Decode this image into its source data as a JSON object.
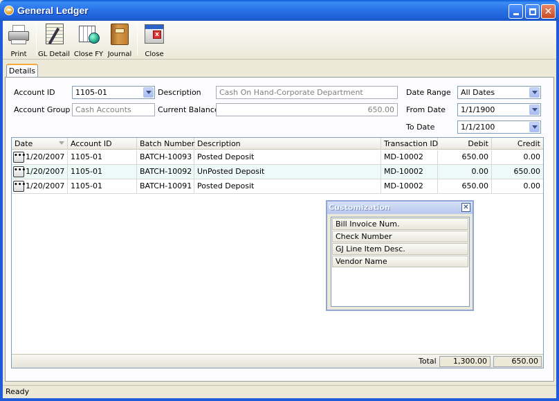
{
  "window": {
    "title": "General Ledger"
  },
  "toolbar": {
    "print": "Print",
    "gl_detail": "GL Detail",
    "close_fy": "Close FY",
    "journal": "Journal",
    "close": "Close"
  },
  "tabs": {
    "details": "Details"
  },
  "form": {
    "account_id_label": "Account ID",
    "account_id_value": "1105-01",
    "description_label": "Description",
    "description_value": "Cash On Hand-Corporate Department",
    "account_group_label": "Account Group",
    "account_group_value": "Cash Accounts",
    "current_balance_label": "Current Balance",
    "current_balance_value": "650.00",
    "date_range_label": "Date Range",
    "date_range_value": "All Dates",
    "from_date_label": "From Date",
    "from_date_value": "1/1/1900",
    "to_date_label": "To Date",
    "to_date_value": "1/1/2100"
  },
  "grid": {
    "columns": [
      "Date",
      "Account ID",
      "Batch Number",
      "Description",
      "Transaction ID",
      "Debit",
      "Credit"
    ],
    "rows": [
      [
        "1/20/2007",
        "1105-01",
        "BATCH-10093",
        "Posted Deposit",
        "MD-10002",
        "650.00",
        "0.00"
      ],
      [
        "1/20/2007",
        "1105-01",
        "BATCH-10092",
        "UnPosted Deposit",
        "MD-10002",
        "0.00",
        "650.00"
      ],
      [
        "1/20/2007",
        "1105-01",
        "BATCH-10091",
        "Posted Deposit",
        "MD-10002",
        "650.00",
        "0.00"
      ]
    ],
    "ellipsis": "•••",
    "footer": {
      "label": "Total",
      "debit": "1,300.00",
      "credit": "650.00"
    }
  },
  "customization": {
    "title": "Customization",
    "close": "✕",
    "items": [
      "Bill Invoice Num.",
      "Check Number",
      "GJ Line Item Desc.",
      "Vendor Name"
    ]
  },
  "status": {
    "text": "Ready"
  },
  "colors": {
    "title_bar": "#1f61d8",
    "tab_accent": "#f5a83c",
    "alt_row": "#eefaf8"
  }
}
